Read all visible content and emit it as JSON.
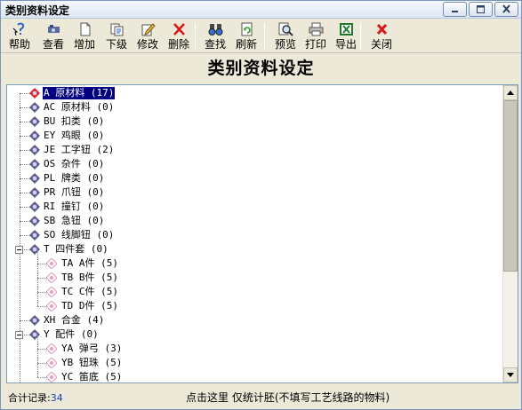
{
  "window": {
    "title": "类别资料设定"
  },
  "toolbar": [
    {
      "id": "help",
      "label": "帮助",
      "icon": "help-icon"
    },
    {
      "id": "view",
      "label": "查看",
      "icon": "view-icon"
    },
    {
      "id": "add",
      "label": "增加",
      "icon": "new-doc-icon"
    },
    {
      "id": "sub",
      "label": "下级",
      "icon": "sublevel-icon"
    },
    {
      "id": "edit",
      "label": "修改",
      "icon": "edit-icon"
    },
    {
      "id": "delete",
      "label": "删除",
      "icon": "delete-icon"
    },
    {
      "id": "find",
      "label": "查找",
      "icon": "binoculars-icon"
    },
    {
      "id": "refresh",
      "label": "刷新",
      "icon": "refresh-icon"
    },
    {
      "id": "preview",
      "label": "预览",
      "icon": "magnifier-icon"
    },
    {
      "id": "print",
      "label": "打印",
      "icon": "printer-icon"
    },
    {
      "id": "export",
      "label": "导出",
      "icon": "excel-icon"
    },
    {
      "id": "close",
      "label": "关闭",
      "icon": "close-icon"
    }
  ],
  "heading": "类别资料设定",
  "tree": [
    {
      "text": "A 原材料 (17)",
      "level": 0,
      "selected": true
    },
    {
      "text": "AC 原材料 (0)",
      "level": 0
    },
    {
      "text": "BU 扣类 (0)",
      "level": 0
    },
    {
      "text": "EY 鸡眼 (0)",
      "level": 0
    },
    {
      "text": "JE 工字钮 (2)",
      "level": 0
    },
    {
      "text": "OS 杂件 (0)",
      "level": 0
    },
    {
      "text": "PL 牌类 (0)",
      "level": 0
    },
    {
      "text": "PR 爪钮 (0)",
      "level": 0
    },
    {
      "text": "RI 撞钉 (0)",
      "level": 0
    },
    {
      "text": "SB 急钮 (0)",
      "level": 0
    },
    {
      "text": "SO 线脚钮 (0)",
      "level": 0
    },
    {
      "text": "T 四件套 (0)",
      "level": 0,
      "expanded": true
    },
    {
      "text": "TA A件 (5)",
      "level": 1
    },
    {
      "text": "TB B件 (5)",
      "level": 1
    },
    {
      "text": "TC C件 (5)",
      "level": 1
    },
    {
      "text": "TD D件 (5)",
      "level": 1
    },
    {
      "text": "XH 合金 (4)",
      "level": 0
    },
    {
      "text": "Y 配件 (0)",
      "level": 0,
      "expanded": true
    },
    {
      "text": "YA 弹弓 (3)",
      "level": 1
    },
    {
      "text": "YB 钮珠 (5)",
      "level": 1
    },
    {
      "text": "YC 笛底 (5)",
      "level": 1
    }
  ],
  "status": {
    "count_label": "合计记录:",
    "count_value": "34",
    "hint": "点击这里  仅统计胚(不填写工艺线路的物料)"
  },
  "colors": {
    "node_root": "#5a5a8c",
    "node_child": "#e6a0c0",
    "selected_bg": "#000080"
  }
}
